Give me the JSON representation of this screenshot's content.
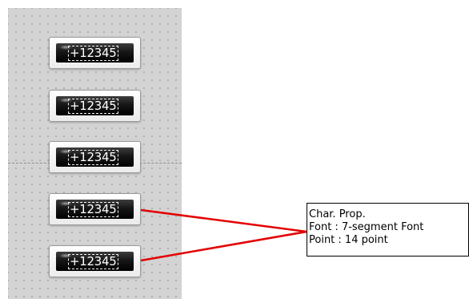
{
  "displays": [
    {
      "value": "+12345"
    },
    {
      "value": "+12345"
    },
    {
      "value": "+12345"
    },
    {
      "value": "+12345"
    },
    {
      "value": "+12345"
    }
  ],
  "callout": {
    "title": "Char. Prop.",
    "font_line": "Font :   7-segment Font",
    "point_line": "Point :  14 point"
  },
  "colors": {
    "canvas": "#d3d3d3",
    "leader_line": "#e30000"
  }
}
